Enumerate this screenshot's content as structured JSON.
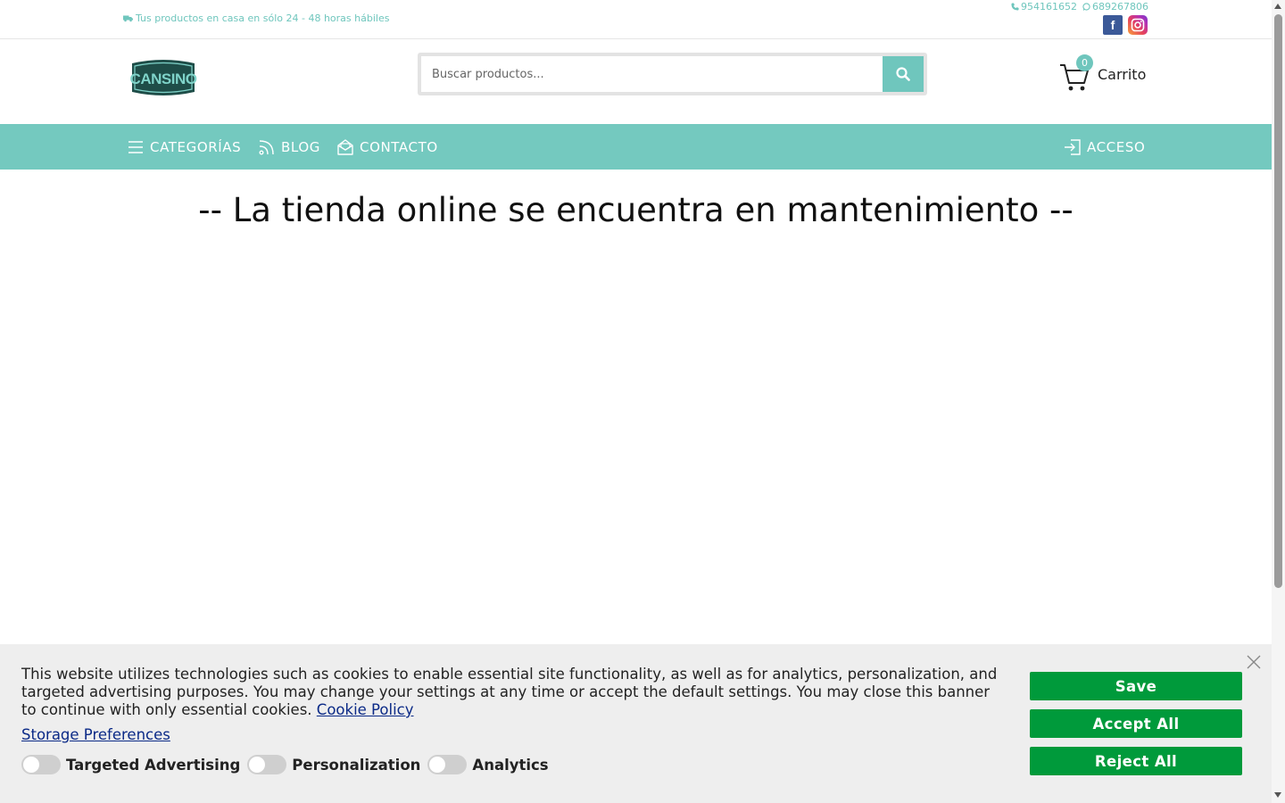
{
  "topbar": {
    "shipping_text": "Tus productos en casa en sólo 24 - 48 horas hábiles",
    "phone": "954161652",
    "whatsapp": "689267806"
  },
  "header": {
    "logo_text": "CANSINO",
    "search_placeholder": "Buscar productos...",
    "cart_count": "0",
    "cart_label": "Carrito"
  },
  "nav": {
    "categories": "CATEGORÍAS",
    "blog": "BLOG",
    "contact": "CONTACTO",
    "login": "ACCESO"
  },
  "main": {
    "title": "-- La tienda online se encuentra en mantenimiento --"
  },
  "cookie": {
    "text": "This website utilizes technologies such as cookies to enable essential site functionality, as well as for analytics, personalization, and targeted advertising purposes. You may change your settings at any time or accept the default settings. You may close this banner to continue with only essential cookies.",
    "policy_link": "Cookie Policy",
    "storage_link": "Storage Preferences",
    "toggles": [
      "Targeted Advertising",
      "Personalization",
      "Analytics"
    ],
    "save": "Save",
    "accept_all": "Accept All",
    "reject_all": "Reject All"
  },
  "colors": {
    "accent": "#74c9bf",
    "button_green": "#009a3b",
    "facebook": "#3b5998"
  }
}
